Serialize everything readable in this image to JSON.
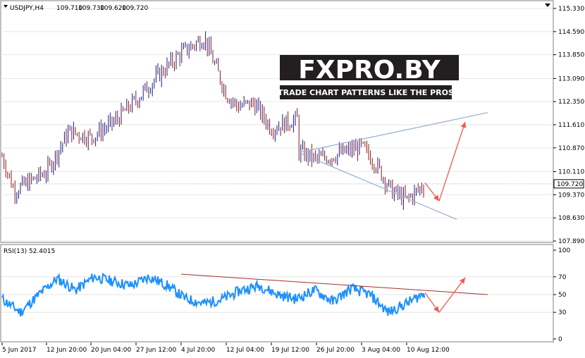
{
  "chart_data": {
    "type": "candlestick",
    "symbol_header": "USDJPY,H4",
    "ohlc_header": [
      "109.710",
      "109.730",
      "109.620",
      "109.720"
    ],
    "price_ticks": [
      "115.330",
      "114.590",
      "113.850",
      "113.090",
      "112.350",
      "111.610",
      "110.870",
      "110.110",
      "109.370",
      "108.630",
      "107.890"
    ],
    "price_ylim": [
      107.89,
      115.33
    ],
    "current_price_label": "109.720",
    "x_ticks": [
      "5 Jun 2017",
      "12 Jun 20:00",
      "20 Jun 04:00",
      "27 Jun 12:00",
      "4 Jul 20:00",
      "12 Jul 04:00",
      "19 Jul 12:00",
      "26 Jul 20:00",
      "3 Aug 04:00",
      "10 Aug 12:00"
    ],
    "price_anchors": {
      "x": [
        "5 Jun 2017",
        "7 Jun",
        "12 Jun 20:00",
        "16 Jun",
        "20 Jun 04:00",
        "24 Jun",
        "27 Jun 12:00",
        "1 Jul",
        "4 Jul 20:00",
        "6 Jul",
        "9 Jul",
        "12 Jul 04:00",
        "14 Jul",
        "17 Jul",
        "19 Jul 12:00",
        "21 Jul",
        "24 Jul",
        "26 Jul 20:00",
        "31 Jul",
        "3 Aug 04:00",
        "5 Aug",
        "8 Aug",
        "10 Aug 12:00",
        "11 Aug"
      ],
      "close": [
        110.6,
        109.5,
        110.1,
        111.4,
        111.2,
        111.7,
        112.4,
        113.2,
        113.9,
        114.4,
        113.5,
        112.6,
        112.2,
        112.3,
        111.5,
        111.8,
        110.9,
        110.5,
        110.6,
        110.9,
        110.4,
        109.5,
        109.2,
        109.72
      ]
    },
    "trendlines": {
      "upper_from": [
        "21 Jul",
        110.72
      ],
      "upper_to": [
        "14 Aug",
        112.0
      ],
      "lower_from": [
        "21 Jul",
        110.72
      ],
      "lower_to": [
        "12 Aug",
        108.58
      ]
    },
    "forecast_arrows": [
      {
        "from": [
          "11 Aug",
          109.75
        ],
        "to": [
          "11 Aug 12:00",
          109.17
        ]
      },
      {
        "from": [
          "11 Aug 12:00",
          109.17
        ],
        "to": [
          "13 Aug",
          111.7
        ]
      }
    ],
    "watermark": {
      "brand": "FXPRO.BY",
      "tagline": "TRADE CHART PATTERNS LIKE THE PROS"
    },
    "rsi": {
      "label": "RSI(13) 52.4015",
      "ticks": [
        "100",
        "70",
        "50",
        "30",
        "0"
      ],
      "ylim": [
        0,
        100
      ],
      "anchors": [
        45,
        30,
        50,
        68,
        55,
        70,
        65,
        60,
        70,
        60,
        45,
        40,
        45,
        55,
        60,
        50,
        45,
        55,
        42,
        57,
        50,
        30,
        40,
        52
      ],
      "trendline_from": [
        "4 Jul 20:00",
        73
      ],
      "trendline_to": [
        "14 Aug",
        50
      ],
      "forecast_arrows": [
        {
          "from": [
            "11 Aug",
            52
          ],
          "to": [
            "11 Aug 12:00",
            30
          ]
        },
        {
          "from": [
            "11 Aug 12:00",
            30
          ],
          "to": [
            "13 Aug",
            69
          ]
        }
      ]
    }
  }
}
